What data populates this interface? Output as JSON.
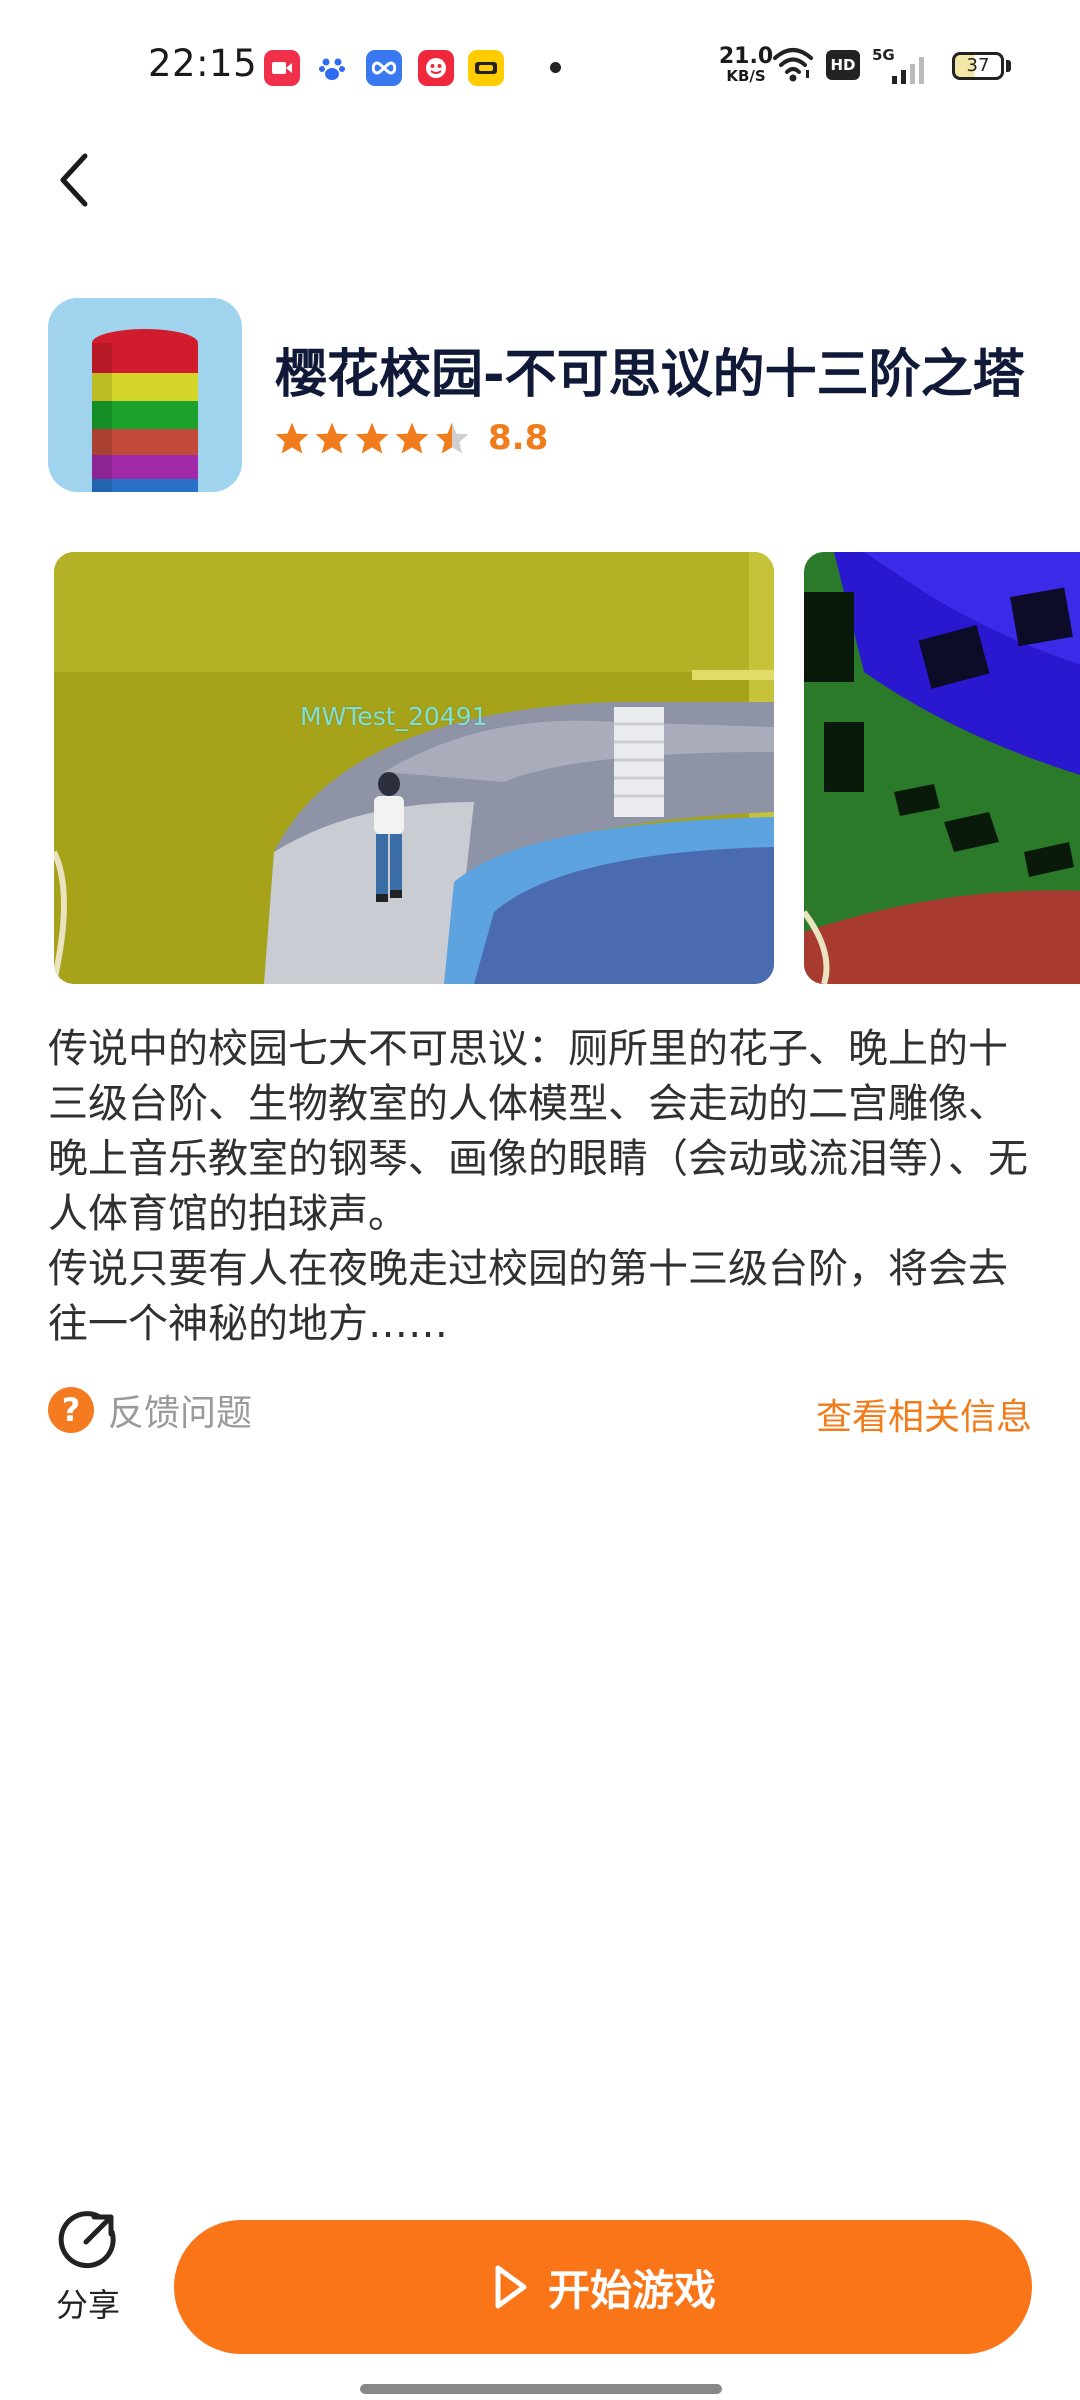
{
  "status_bar": {
    "time": "22:15",
    "apps": [
      {
        "name": "video-app-icon",
        "color": "#f0304a",
        "glyph": "▶"
      },
      {
        "name": "baidu-icon",
        "color": "#2f6bf0",
        "glyph": "✿"
      },
      {
        "name": "infinity-app-icon",
        "color": "#3a78f2",
        "glyph": "∞"
      },
      {
        "name": "taote-app-icon",
        "color": "#f0283c",
        "glyph": "淘"
      },
      {
        "name": "meituan-icon",
        "color": "#ffcc00",
        "glyph": "美"
      }
    ],
    "net_speed_value": "21.0",
    "net_speed_unit": "KB/S",
    "hd_label": "HD",
    "signal_label": "5G",
    "battery_level": "37"
  },
  "header": {
    "title": "樱花校园-不可思议的十三阶之塔",
    "rating_value": "8.8",
    "rating_stars": 4.5,
    "star_color": "#f07c1c"
  },
  "screenshots": {
    "overlay_text": "MWTest_20491"
  },
  "description": {
    "paragraph_1": "传说中的校园七大不可思议：厕所里的花子、晚上的十三级台阶、生物教室的人体模型、会走动的二宫雕像、晚上音乐教室的钢琴、画像的眼睛（会动或流泪等）、无人体育馆的拍球声。",
    "paragraph_2": "传说只要有人在夜晚走过校园的第十三级台阶，将会去往一个神秘的地方……"
  },
  "feedback": {
    "icon_glyph": "?",
    "label": "反馈问题",
    "related_link": "查看相关信息"
  },
  "bottom_bar": {
    "share_label": "分享",
    "start_label": "开始游戏",
    "accent_color": "#fa7418"
  }
}
